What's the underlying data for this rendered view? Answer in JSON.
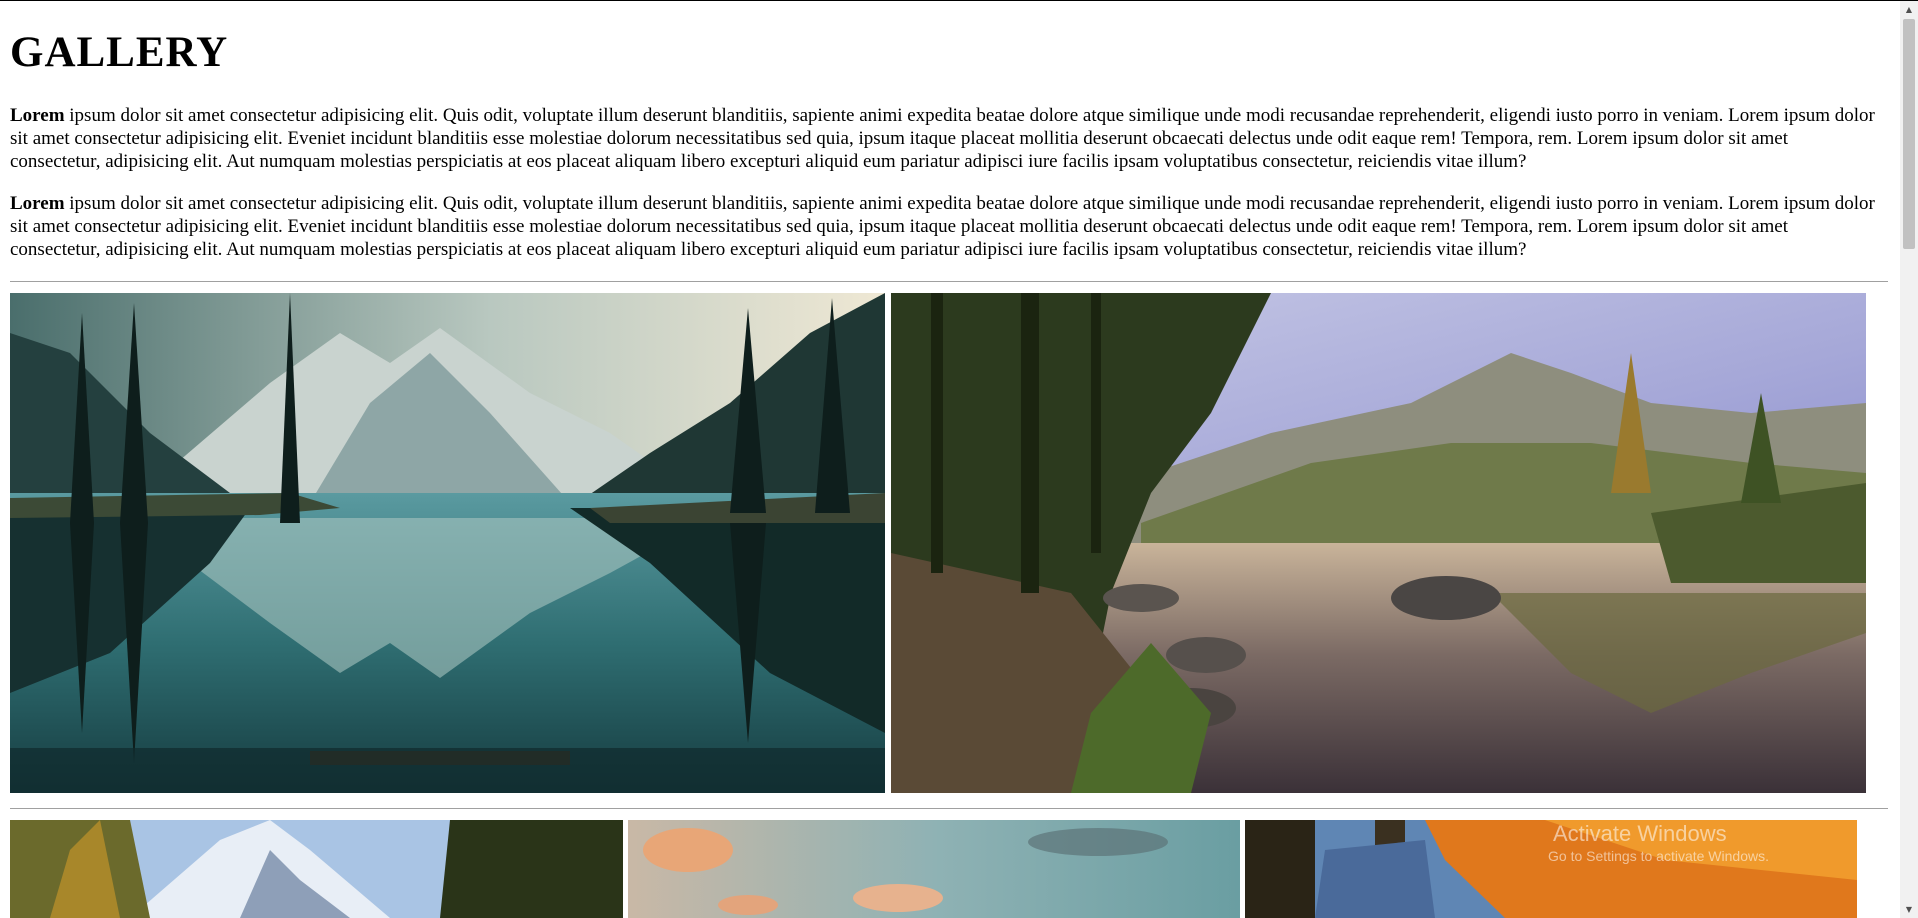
{
  "page": {
    "title": "GALLERY",
    "paragraphs": [
      {
        "bold": "Lorem",
        "text": " ipsum dolor sit amet consectetur adipisicing elit. Quis odit, voluptate illum deserunt blanditiis, sapiente animi expedita beatae dolore atque similique unde modi recusandae reprehenderit, eligendi iusto porro in veniam. Lorem ipsum dolor sit amet consectetur adipisicing elit. Eveniet incidunt blanditiis esse molestiae dolorum necessitatibus sed quia, ipsum itaque placeat mollitia deserunt obcaecati delectus unde odit eaque rem! Tempora, rem. Lorem ipsum dolor sit amet consectetur, adipisicing elit. Aut numquam molestias perspiciatis at eos placeat aliquam libero excepturi aliquid eum pariatur adipisci iure facilis ipsam voluptatibus consectetur, reiciendis vitae illum?"
      },
      {
        "bold": "Lorem",
        "text": " ipsum dolor sit amet consectetur adipisicing elit. Quis odit, voluptate illum deserunt blanditiis, sapiente animi expedita beatae dolore atque similique unde modi recusandae reprehenderit, eligendi iusto porro in veniam. Lorem ipsum dolor sit amet consectetur adipisicing elit. Eveniet incidunt blanditiis esse molestiae dolorum necessitatibus sed quia, ipsum itaque placeat mollitia deserunt obcaecati delectus unde odit eaque rem! Tempora, rem. Lorem ipsum dolor sit amet consectetur, adipisicing elit. Aut numquam molestias perspiciatis at eos placeat aliquam libero excepturi aliquid eum pariatur adipisci iure facilis ipsam voluptatibus consectetur, reiciendis vitae illum?"
      }
    ]
  },
  "gallery": {
    "row1": [
      {
        "scene": "mountain-lake-reflection-teal"
      },
      {
        "scene": "forest-lake-rocks-sunset"
      }
    ],
    "row2": [
      {
        "scene": "snowy-mountain-larch"
      },
      {
        "scene": "sunset-clouds-teal-sky"
      },
      {
        "scene": "autumn-forest-orange"
      }
    ]
  },
  "watermark": {
    "title": "Activate Windows",
    "subtitle": "Go to Settings to activate Windows."
  },
  "colors": {
    "background": "#ffffff",
    "text": "#000000",
    "rule": "#a0a0a0"
  }
}
